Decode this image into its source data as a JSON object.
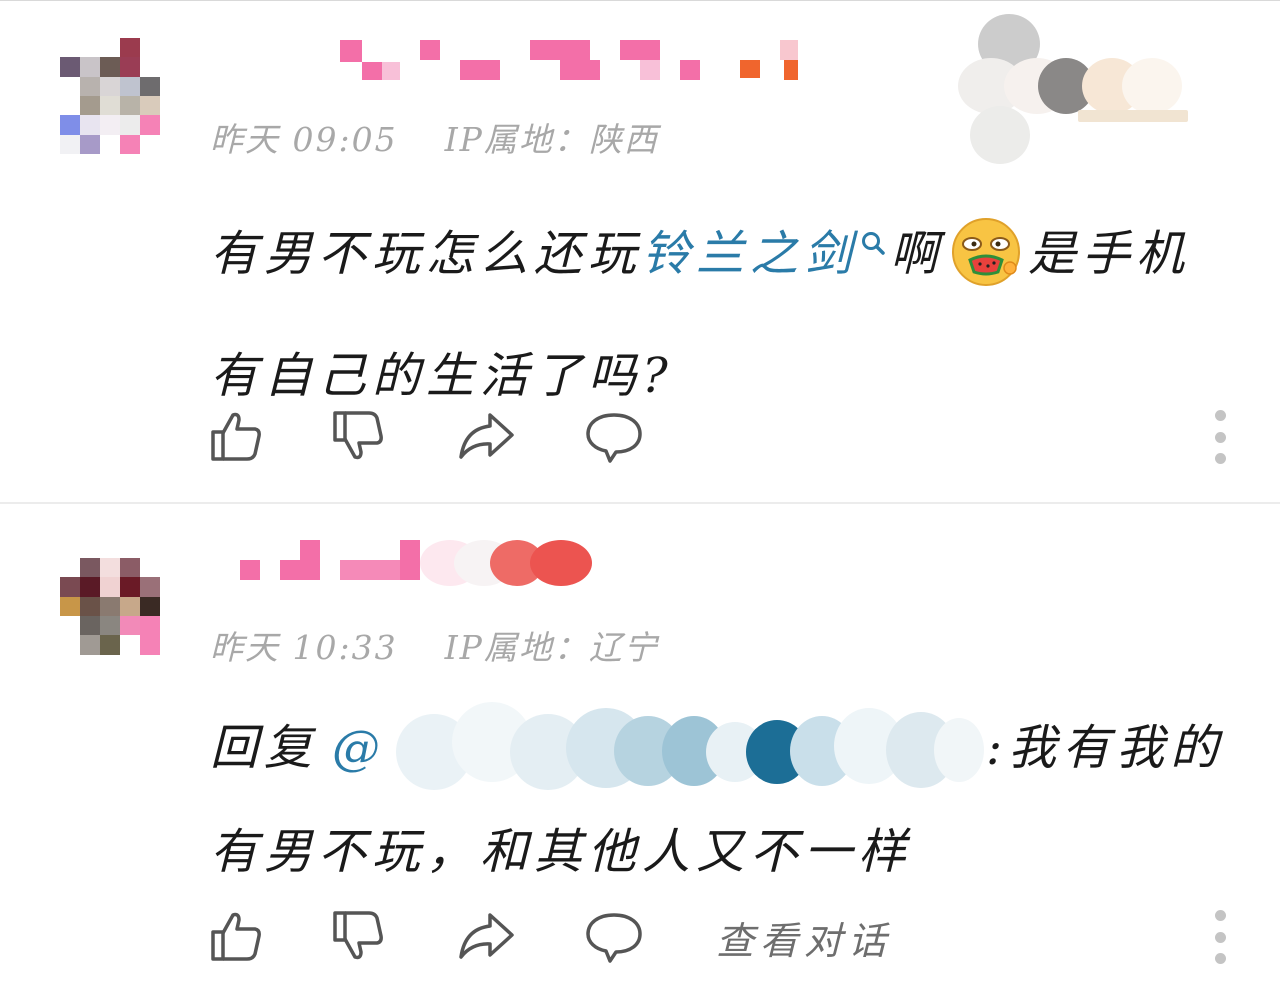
{
  "comments": [
    {
      "timestamp": "昨天 09:05",
      "ip_location": "IP属地：陕西",
      "text_before_link": "有男不玩怎么还玩",
      "link_text": "铃兰之剑",
      "text_after_link": "啊",
      "text_after_emoji": "是手机有自己的生活了吗?",
      "icons": {
        "search": "search-icon",
        "emoji": "watermelon-eating-emoji-icon",
        "like": "thumbs-up-icon",
        "dislike": "thumbs-down-icon",
        "share": "share-arrow-icon",
        "reply": "speech-bubble-icon",
        "more": "more-vertical-icon"
      }
    },
    {
      "timestamp": "昨天 10:33",
      "ip_location": "IP属地：辽宁",
      "reply_prefix": "回复",
      "mention_at": "@",
      "text_after_mention": ":我有我的有男不玩，和其他人又不一样",
      "view_dialog_label": "查看对话",
      "icons": {
        "like": "thumbs-up-icon",
        "dislike": "thumbs-down-icon",
        "share": "share-arrow-icon",
        "reply": "speech-bubble-icon",
        "more": "more-vertical-icon"
      }
    }
  ],
  "colors": {
    "link": "#2a7ba8",
    "meta": "#a8a8a8",
    "icon_stroke": "#555555",
    "divider": "#ececec"
  }
}
